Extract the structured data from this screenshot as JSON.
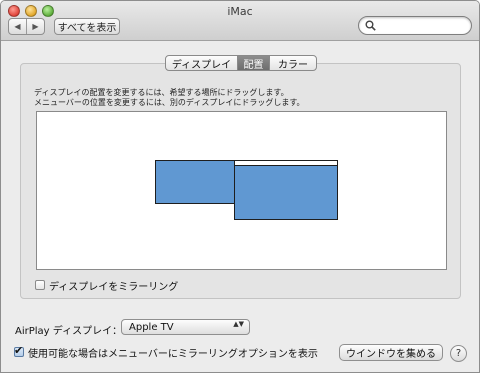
{
  "window": {
    "title": "iMac",
    "back_glyph": "◀",
    "forward_glyph": "▶",
    "show_all_label": "すべてを表示"
  },
  "search": {
    "value": "",
    "placeholder": ""
  },
  "tabs": [
    {
      "label": "ディスプレイ",
      "selected": false
    },
    {
      "label": "配置",
      "selected": true
    },
    {
      "label": "カラー",
      "selected": false
    }
  ],
  "instructions": [
    "ディスプレイの配置を変更するには、希望する場所にドラッグします。",
    "メニューバーの位置を変更するには、別のディスプレイにドラッグします。"
  ],
  "arrangement": {
    "display_color": "#6098d2",
    "displays": [
      {
        "name": "secondary",
        "has_menubar": false
      },
      {
        "name": "primary",
        "has_menubar": true
      }
    ]
  },
  "mirror": {
    "label": "ディスプレイをミラーリング",
    "checked": false
  },
  "airplay": {
    "label": "AirPlay ディスプレイ：",
    "selected": "Apple TV",
    "arrows": "▲▼"
  },
  "show_mirroring_option": {
    "label": "使用可能な場合はメニューバーにミラーリングオプションを表示",
    "checked": true,
    "check_glyph": "✔"
  },
  "gather_windows_label": "ウインドウを集める",
  "help_label": "?"
}
